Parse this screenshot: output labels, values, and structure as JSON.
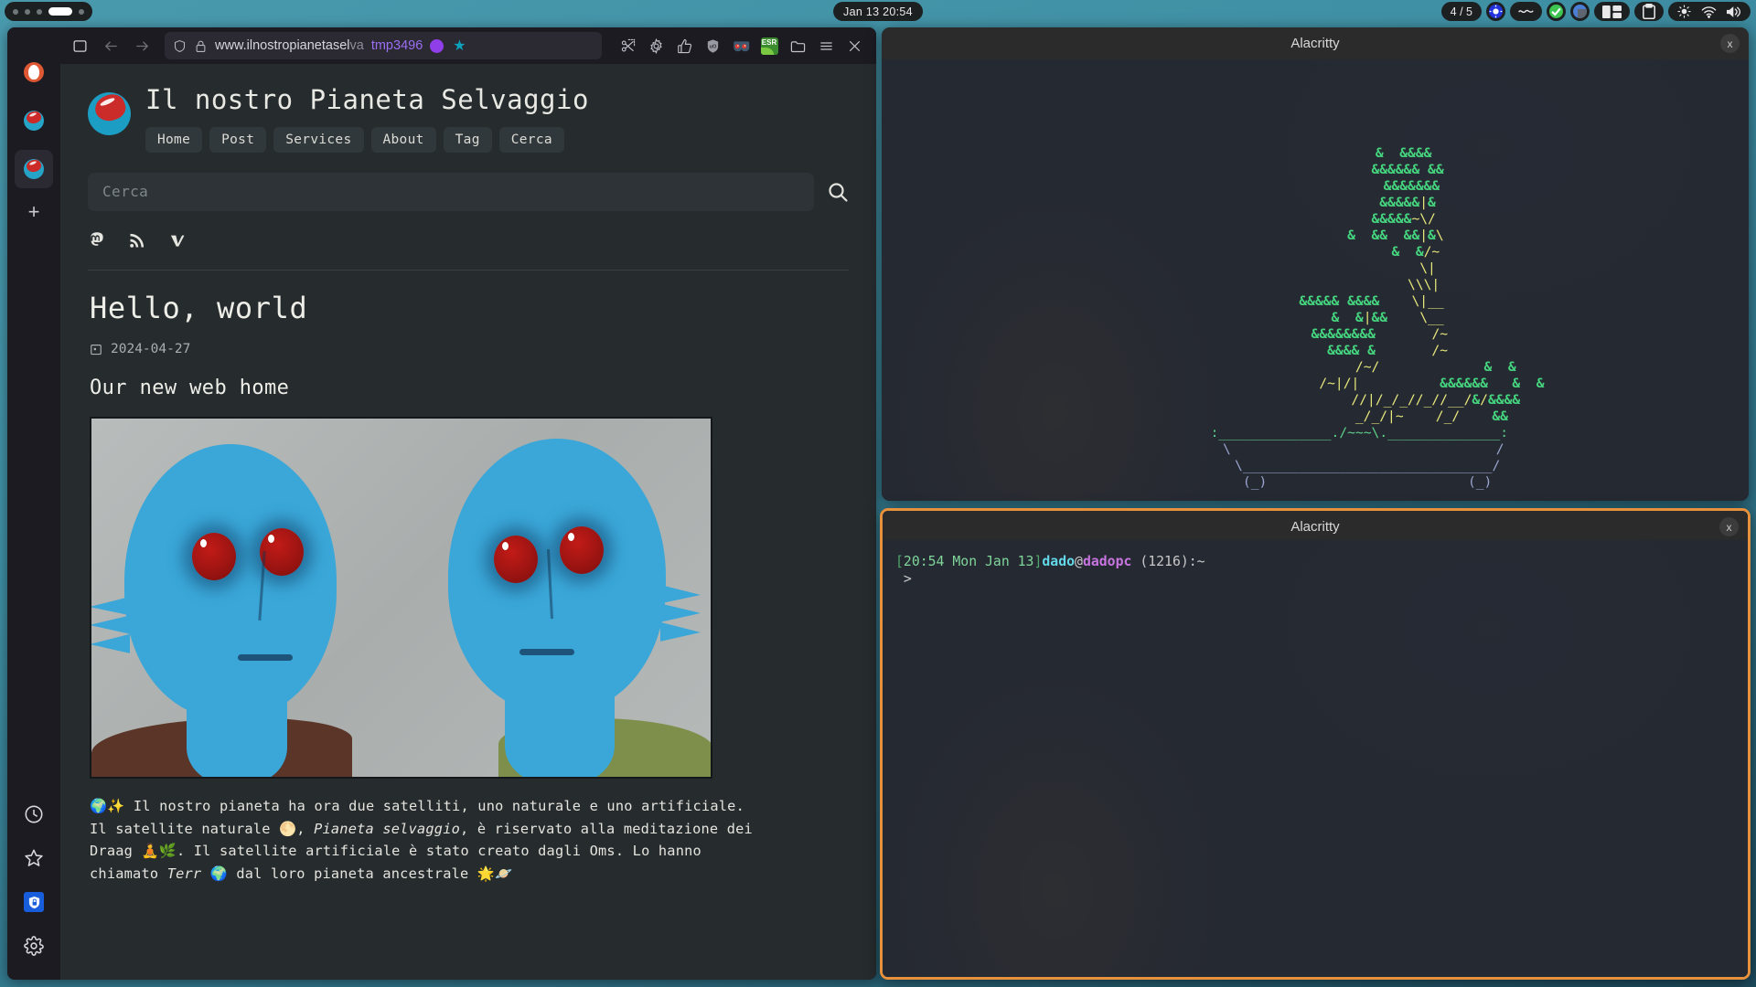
{
  "topbar": {
    "workspace_label": "4 dots with active pill",
    "workspace_count": 5,
    "workspace_active": 4,
    "clock": "Jan 13  20:54",
    "page_indicator": "4 / 5",
    "tray_icons": [
      "brightness-blue-icon",
      "wave-icon",
      "check-green-icon",
      "bluetooth-icon",
      "window-layout-icon",
      "clipboard-icon",
      "brightness-icon",
      "wifi-icon",
      "volume-icon"
    ]
  },
  "firefox": {
    "tabs": [
      {
        "name": "tab-duckduckgo",
        "favicon": "duckduckgo-icon",
        "indicator_color": "#d8d8d8",
        "selected": false
      },
      {
        "name": "tab-planet-1",
        "favicon": "planet-icon",
        "indicator_color": "#9b6ef3",
        "selected": false
      },
      {
        "name": "tab-planet-2",
        "favicon": "planet-icon",
        "indicator_color": "#9b6ef3",
        "selected": true
      }
    ],
    "new_tab_label": "+",
    "tab_close_label": "×",
    "sidebar_bottom": [
      "history-clock-icon",
      "bookmarks-star-icon",
      "bitwarden-vault-icon",
      "settings-gear-icon"
    ],
    "nav": {
      "sidebar_toggle": "sidebar-toggle-icon",
      "back": "back-arrow-icon",
      "forward": "forward-arrow-icon",
      "shield": "shield-icon",
      "lock": "lock-icon",
      "url_visible": "www.ilnostropianetaselva",
      "url_bold": "www.ilnostropianetasel",
      "url_dim": "va",
      "container_tag": "tmp3496",
      "container_color": "#8f3ee8",
      "bookmark_star": "★",
      "bookmark_color": "#0ca2bc"
    },
    "extensions": [
      {
        "name": "screenshot-scissors-icon"
      },
      {
        "name": "gear-icon"
      },
      {
        "name": "thumbs-up-icon"
      },
      {
        "name": "ublock-origin-icon"
      },
      {
        "name": "glasses-face-icon"
      },
      {
        "name": "esr-leaf-badge-icon",
        "label": "ESR"
      },
      {
        "name": "folder-icon"
      },
      {
        "name": "hamburger-menu-icon"
      },
      {
        "name": "close-window-icon"
      }
    ]
  },
  "site": {
    "title": "Il nostro Pianeta Selvaggio",
    "logo": "planet-logo-icon",
    "nav": [
      "Home",
      "Post",
      "Services",
      "About",
      "Tag",
      "Cerca"
    ],
    "search_placeholder": "Cerca",
    "search_icon": "search-icon",
    "socials": [
      "mastodon-icon",
      "rss-icon",
      "vimeo-icon"
    ]
  },
  "post": {
    "title": "Hello, world",
    "date": "2024-04-27",
    "date_icon": "calendar-icon",
    "subtitle": "Our new web home",
    "image_alt": "two blue Draag aliens with red eyes",
    "body_1": "🌍✨ Il nostro pianeta ha ora due satelliti, uno naturale e uno artificiale. Il satellite naturale 🌕, ",
    "body_em_1": "Pianeta selvaggio",
    "body_2": ", è riservato alla meditazione dei Draag 🧘🌿. Il satellite artificiale è stato creato dagli Oms. Lo hanno chiamato ",
    "body_em_2": "Terr",
    "body_3": " 🌍 dal loro pianeta ancestrale 🌟🪐"
  },
  "terminals": [
    {
      "name": "alacritty-top",
      "title": "Alacritty",
      "close_label": "x",
      "focused": false,
      "content_type": "cbonsai-ascii-art"
    },
    {
      "name": "alacritty-bottom",
      "title": "Alacritty",
      "close_label": "x",
      "focused": true,
      "border_color": "#e8913c",
      "prompt": {
        "bracket_open": "[",
        "time": "20:54 Mon Jan 13",
        "bracket_close": "]",
        "user": "dado",
        "at": "@",
        "host": "dadopc",
        "jobs": " (1216):~",
        "cursor_line": " >"
      }
    }
  ],
  "bonsai_art": [
    "                      &  &&&&",
    "                       &&&&&& &&",
    "                        &&&&&&&",
    "                       &&&&&|&",
    "                      &&&&&~\\/",
    "                    &  &&  &&|&\\",
    "                         &  &/~",
    "                            \\|",
    "                           \\\\\\|",
    "              &&&&& &&&&    \\|__",
    "                  &  &|&&    \\__",
    "                &&&&&&&&       /~",
    "                  &&&& &       /~",
    "                              /~/             &  &",
    "                             /~|/|          &&&&&&   &  &",
    "                              //|/_/_//_//__/&/&&&&",
    "                             _/_/|~    /_/    &&",
    "           :______________./~~~\\.______________:",
    "            \\                                 /",
    "             \\_______________________________/",
    "             (_)                         (_)"
  ],
  "colors": {
    "desktop": "#3f8fa4",
    "firefox_chrome": "#1c1b22",
    "page_bg": "#262b2e",
    "terminal_bg": "#252932",
    "focus_border": "#e8913c",
    "leaf_green": "#45d67f",
    "branch_yellow": "#e8e87a",
    "container_purple": "#9b6ef3"
  }
}
